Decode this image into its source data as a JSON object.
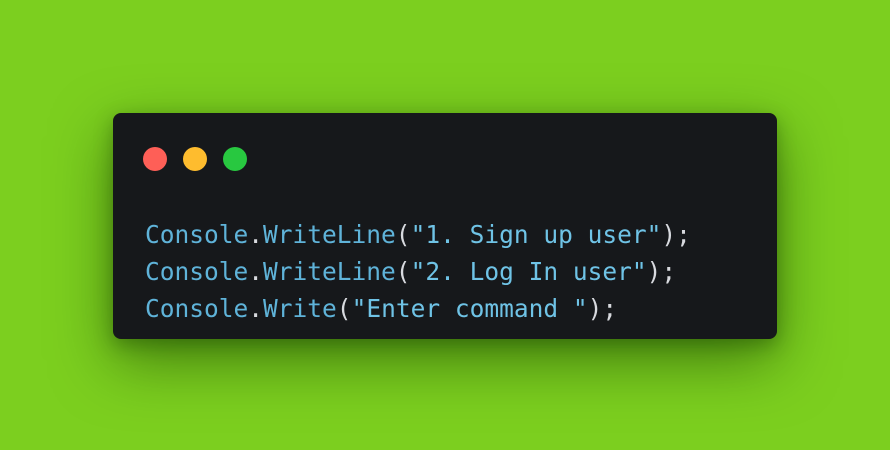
{
  "window": {
    "controls": {
      "close": "close-dot",
      "minimize": "minimize-dot",
      "zoom": "zoom-dot"
    },
    "colors": {
      "background": "#7ccf1f",
      "panel": "#16181b",
      "close": "#fe5f57",
      "minimize": "#febc2e",
      "zoom": "#28c840",
      "identifier": "#5fb3d9",
      "punctuation": "#d8dadf"
    }
  },
  "code": {
    "lines": [
      {
        "object": "Console",
        "dot": ".",
        "method": "WriteLine",
        "open": "(",
        "string": "\"1. Sign up user\"",
        "close": ");"
      },
      {
        "object": "Console",
        "dot": ".",
        "method": "WriteLine",
        "open": "(",
        "string": "\"2. Log In user\"",
        "close": ");"
      },
      {
        "object": "Console",
        "dot": ".",
        "method": "Write",
        "open": "(",
        "string": "\"Enter command \"",
        "close": ");"
      }
    ]
  }
}
